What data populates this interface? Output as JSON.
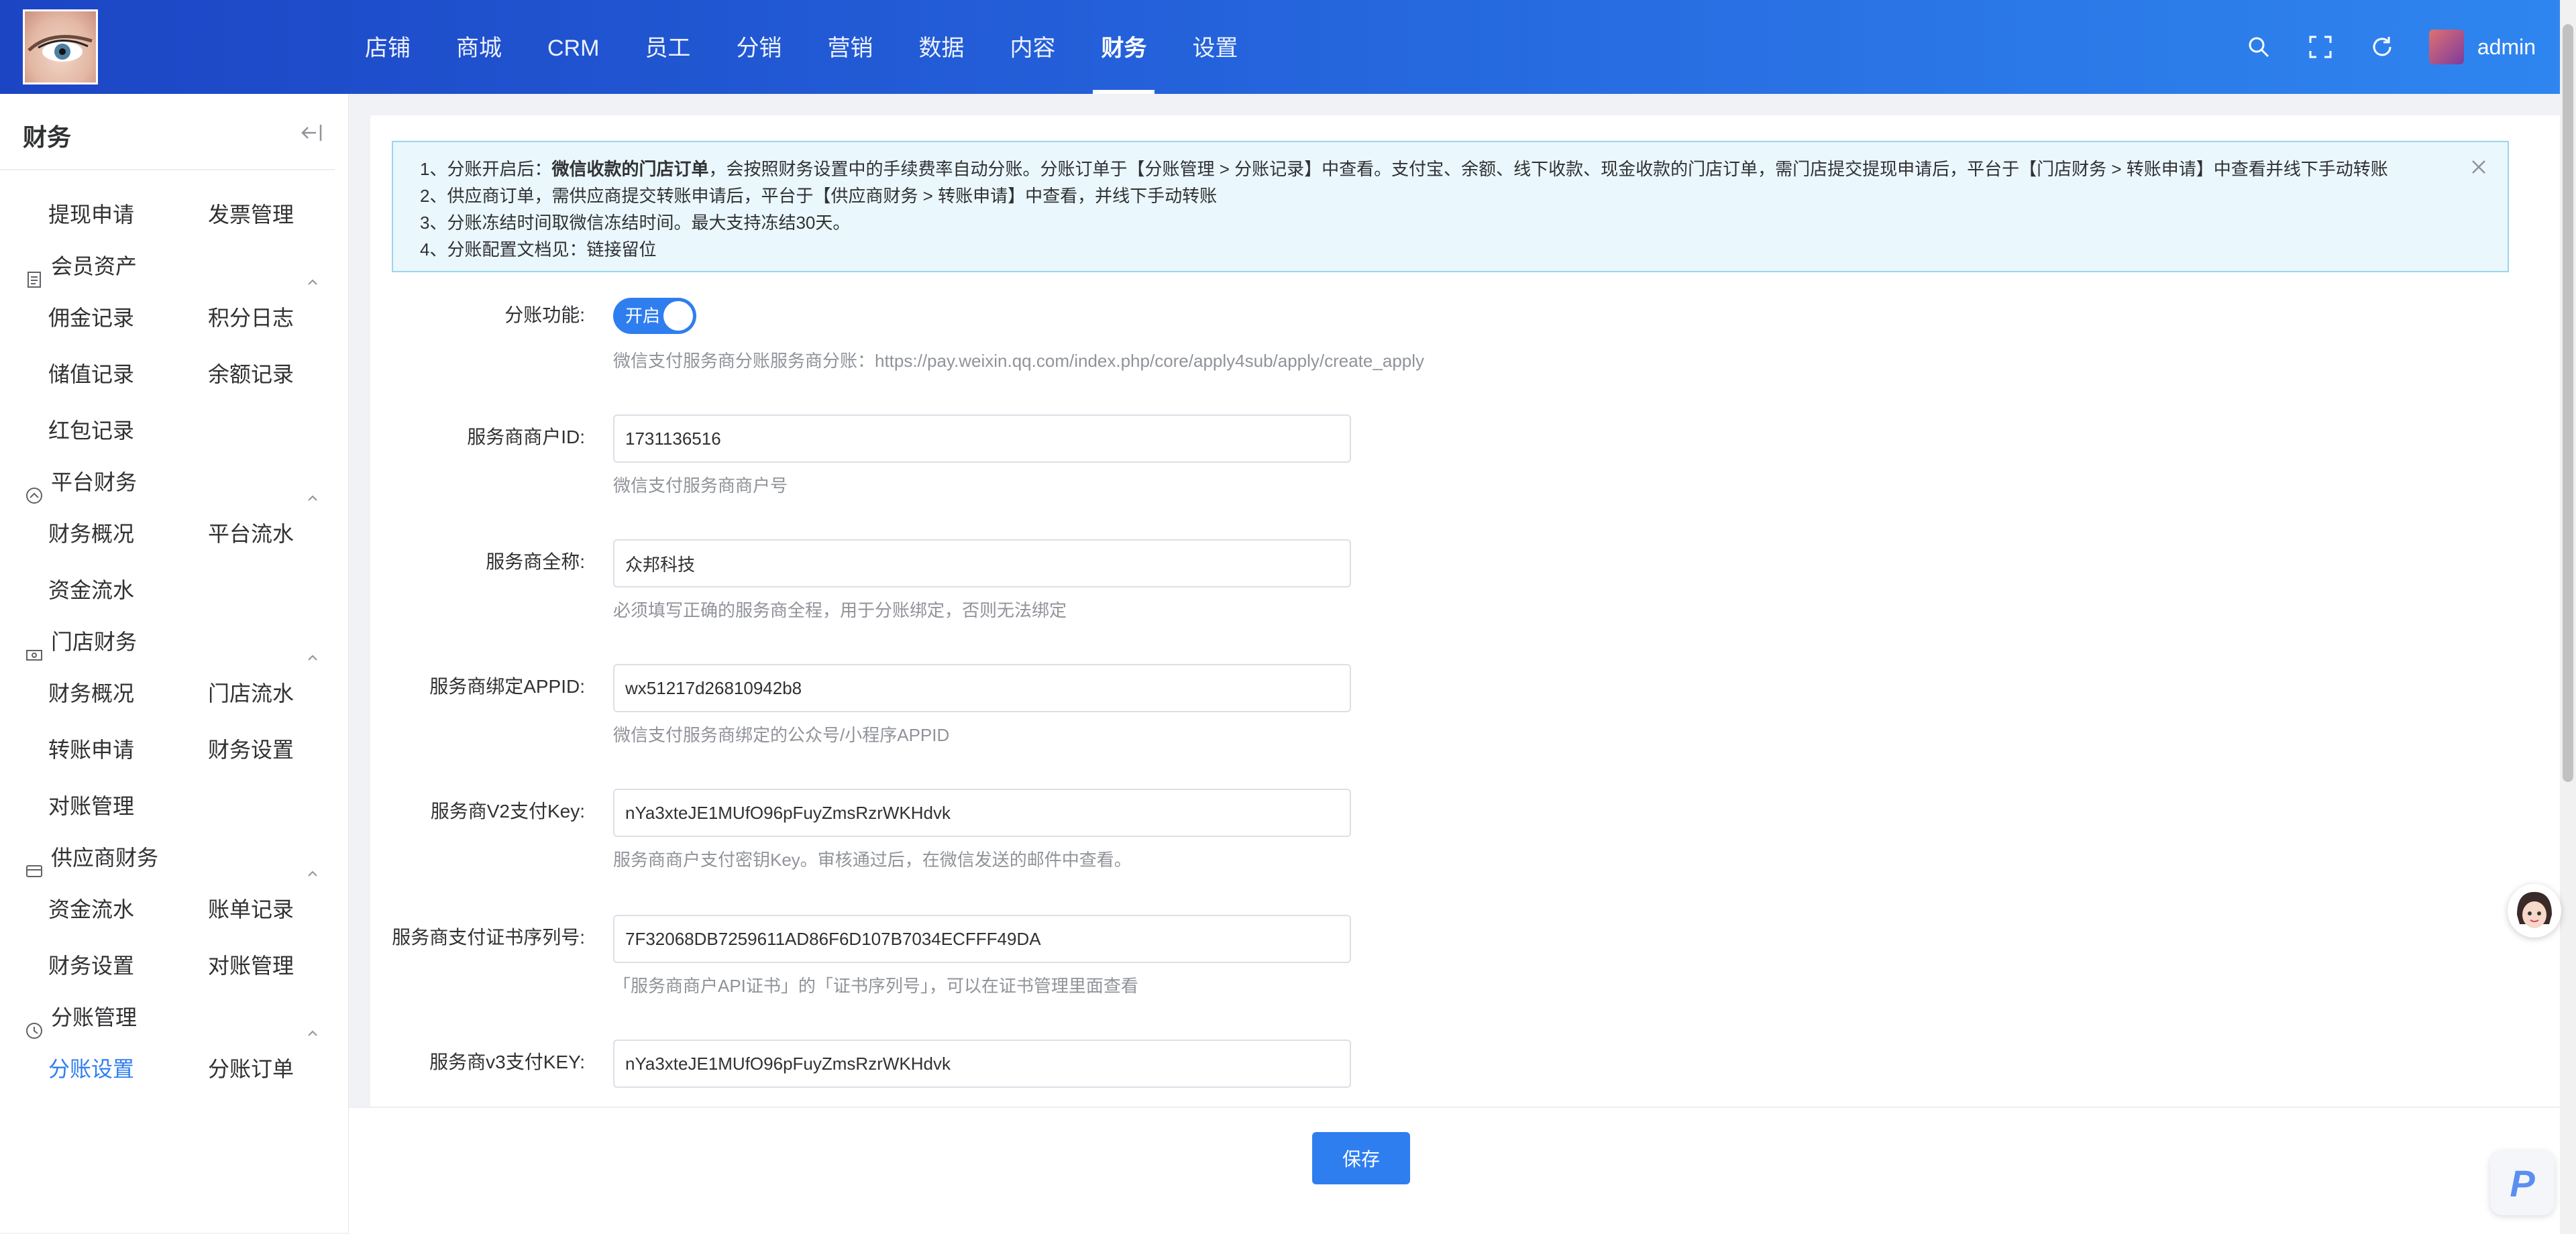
{
  "topnav": {
    "items": [
      {
        "label": "店铺"
      },
      {
        "label": "商城"
      },
      {
        "label": "CRM"
      },
      {
        "label": "员工"
      },
      {
        "label": "分销"
      },
      {
        "label": "营销"
      },
      {
        "label": "数据"
      },
      {
        "label": "内容"
      },
      {
        "label": "财务",
        "active": true
      },
      {
        "label": "设置"
      }
    ],
    "user": "admin"
  },
  "sidebar": {
    "title": "财务",
    "top_items": [
      "提现申请",
      "发票管理"
    ],
    "groups": [
      {
        "title": "会员资产",
        "icon": "document-icon",
        "items": [
          "佣金记录",
          "积分日志",
          "储值记录",
          "余额记录",
          "红包记录"
        ]
      },
      {
        "title": "平台财务",
        "icon": "platform-icon",
        "items": [
          "财务概况",
          "平台流水",
          "资金流水"
        ]
      },
      {
        "title": "门店财务",
        "icon": "cash-icon",
        "items": [
          "财务概况",
          "门店流水",
          "转账申请",
          "财务设置",
          "对账管理"
        ]
      },
      {
        "title": "供应商财务",
        "icon": "card-icon",
        "items": [
          "资金流水",
          "账单记录",
          "财务设置",
          "对账管理"
        ]
      },
      {
        "title": "分账管理",
        "icon": "split-icon",
        "items": [
          "分账设置",
          "分账订单"
        ],
        "active": "分账设置"
      }
    ]
  },
  "alert": {
    "line1_prefix": "1、分账开启后：",
    "line1_bold": "微信收款的门店订单",
    "line1_rest": "，会按照财务设置中的手续费率自动分账。分账订单于【分账管理 > 分账记录】中查看。支付宝、余额、线下收款、现金收款的门店订单，需门店提交提现申请后，平台于【门店财务 > 转账申请】中查看并线下手动转账",
    "line2": "2、供应商订单，需供应商提交转账申请后，平台于【供应商财务 > 转账申请】中查看，并线下手动转账",
    "line3": "3、分账冻结时间取微信冻结时间。最大支持冻结30天。",
    "line4": "4、分账配置文档见：链接留位"
  },
  "form": {
    "switch_label": "分账功能:",
    "switch_text": "开启",
    "switch_on": true,
    "switch_help": "微信支付服务商分账服务商分账：https://pay.weixin.qq.com/index.php/core/apply4sub/apply/create_apply",
    "fields": [
      {
        "label": "服务商商户ID:",
        "value": "1731136516",
        "help": "微信支付服务商商户号"
      },
      {
        "label": "服务商全称:",
        "value": "众邦科技",
        "help": "必须填写正确的服务商全程，用于分账绑定，否则无法绑定"
      },
      {
        "label": "服务商绑定APPID:",
        "value": "wx51217d26810942b8",
        "help": "微信支付服务商绑定的公众号/小程序APPID"
      },
      {
        "label": "服务商V2支付Key:",
        "value": "nYa3xteJE1MUfO96pFuyZmsRzrWKHdvk",
        "help": "服务商商户支付密钥Key。审核通过后，在微信发送的邮件中查看。"
      },
      {
        "label": "服务商支付证书序列号:",
        "value": "7F32068DB7259611AD86F6D107B7034ECFFF49DA",
        "help": "「服务商商户API证书」的「证书序列号」，可以在证书管理里面查看"
      },
      {
        "label": "服务商v3支付KEY:",
        "value": "nYa3xteJE1MUfO96pFuyZmsRzrWKHdvk",
        "help": ""
      }
    ]
  },
  "footer": {
    "save_label": "保存"
  },
  "colors": {
    "primary": "#2f7ef0",
    "header_start": "#1c45c4",
    "header_end": "#2f86f0",
    "alert_bg": "#eaf7fc",
    "alert_border": "#9ad5ee"
  }
}
